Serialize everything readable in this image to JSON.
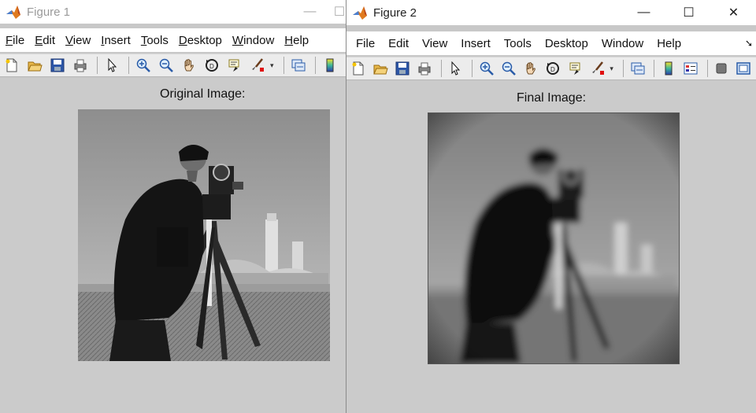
{
  "windows": [
    {
      "title": "Figure 1",
      "menu": [
        {
          "label": "File",
          "mnemonic": "F",
          "rest": "ile"
        },
        {
          "label": "Edit",
          "mnemonic": "E",
          "rest": "dit"
        },
        {
          "label": "View",
          "mnemonic": "V",
          "rest": "iew"
        },
        {
          "label": "Insert",
          "mnemonic": "I",
          "rest": "nsert"
        },
        {
          "label": "Tools",
          "mnemonic": "T",
          "rest": "ools"
        },
        {
          "label": "Desktop",
          "mnemonic": "D",
          "rest": "esktop"
        },
        {
          "label": "Window",
          "mnemonic": "W",
          "rest": "indow"
        },
        {
          "label": "Help",
          "mnemonic": "H",
          "rest": "elp"
        }
      ],
      "axes_title": "Original Image:",
      "image": "cameraman-original"
    },
    {
      "title": "Figure 2",
      "menu": [
        {
          "label": "File"
        },
        {
          "label": "Edit"
        },
        {
          "label": "View"
        },
        {
          "label": "Insert"
        },
        {
          "label": "Tools"
        },
        {
          "label": "Desktop"
        },
        {
          "label": "Window"
        },
        {
          "label": "Help"
        }
      ],
      "axes_title": "Final Image:",
      "image": "cameraman-blurred"
    }
  ],
  "toolbar_icons": [
    "new-figure-icon",
    "open-file-icon",
    "save-icon",
    "print-icon",
    "pointer-icon",
    "zoom-in-icon",
    "zoom-out-icon",
    "pan-icon",
    "rotate-3d-icon",
    "data-cursor-icon",
    "brush-icon",
    "link-plot-icon",
    "colorbar-icon",
    "legend-icon",
    "plot-tools-icon",
    "dock-icon"
  ],
  "colors": {
    "matlab_orange": "#e07a1f",
    "figure_bg": "#cbcbcb",
    "toolbar_bg": "#ececec"
  }
}
